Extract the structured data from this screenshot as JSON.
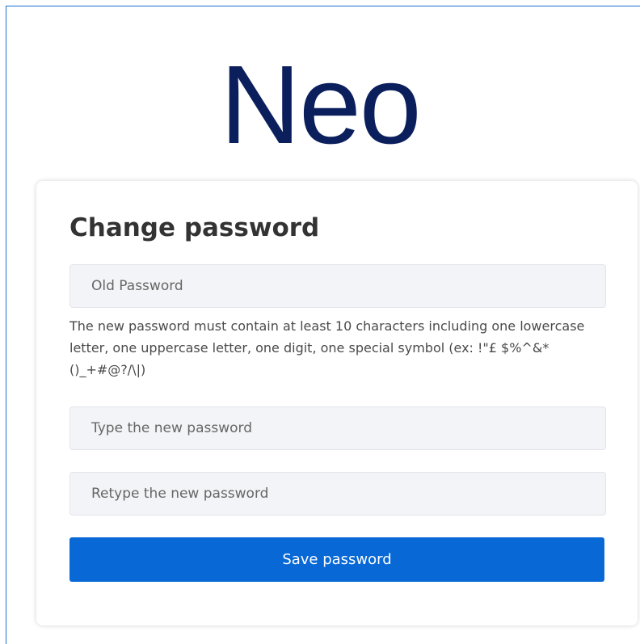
{
  "logo": {
    "text": "Neo"
  },
  "form": {
    "title": "Change password",
    "old_password_placeholder": "Old Password",
    "hint": "The new password must contain at least 10 characters including one lowercase letter, one uppercase letter, one digit, one special symbol (ex: !\"£ $%^&*()_+#@?/\\|)",
    "new_password_placeholder": "Type the new password",
    "retype_password_placeholder": "Retype the new password",
    "save_label": "Save password"
  },
  "colors": {
    "logo": "#0a1f5c",
    "accent": "#0868d6",
    "field_bg": "#f3f4f7",
    "frame_border": "#1a6fd0"
  }
}
